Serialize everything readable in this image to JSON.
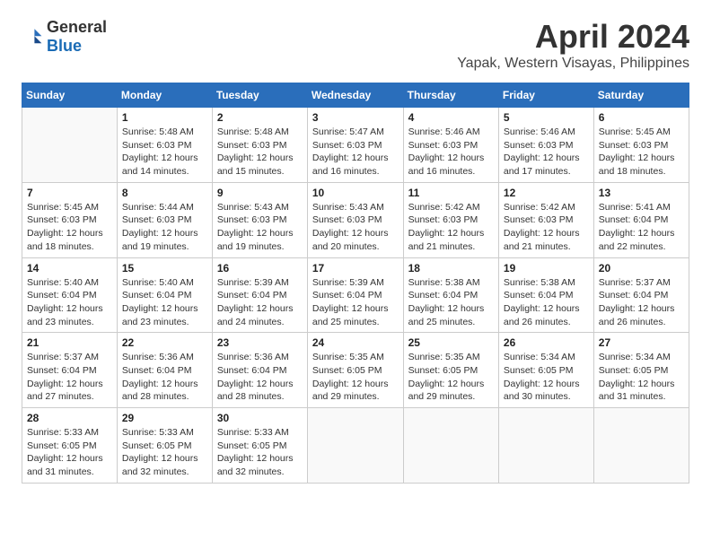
{
  "header": {
    "logo_general": "General",
    "logo_blue": "Blue",
    "title": "April 2024",
    "subtitle": "Yapak, Western Visayas, Philippines"
  },
  "days_of_week": [
    "Sunday",
    "Monday",
    "Tuesday",
    "Wednesday",
    "Thursday",
    "Friday",
    "Saturday"
  ],
  "weeks": [
    [
      {
        "day": "",
        "sunrise": "",
        "sunset": "",
        "daylight": ""
      },
      {
        "day": "1",
        "sunrise": "Sunrise: 5:48 AM",
        "sunset": "Sunset: 6:03 PM",
        "daylight": "Daylight: 12 hours and 14 minutes."
      },
      {
        "day": "2",
        "sunrise": "Sunrise: 5:48 AM",
        "sunset": "Sunset: 6:03 PM",
        "daylight": "Daylight: 12 hours and 15 minutes."
      },
      {
        "day": "3",
        "sunrise": "Sunrise: 5:47 AM",
        "sunset": "Sunset: 6:03 PM",
        "daylight": "Daylight: 12 hours and 16 minutes."
      },
      {
        "day": "4",
        "sunrise": "Sunrise: 5:46 AM",
        "sunset": "Sunset: 6:03 PM",
        "daylight": "Daylight: 12 hours and 16 minutes."
      },
      {
        "day": "5",
        "sunrise": "Sunrise: 5:46 AM",
        "sunset": "Sunset: 6:03 PM",
        "daylight": "Daylight: 12 hours and 17 minutes."
      },
      {
        "day": "6",
        "sunrise": "Sunrise: 5:45 AM",
        "sunset": "Sunset: 6:03 PM",
        "daylight": "Daylight: 12 hours and 18 minutes."
      }
    ],
    [
      {
        "day": "7",
        "sunrise": "Sunrise: 5:45 AM",
        "sunset": "Sunset: 6:03 PM",
        "daylight": "Daylight: 12 hours and 18 minutes."
      },
      {
        "day": "8",
        "sunrise": "Sunrise: 5:44 AM",
        "sunset": "Sunset: 6:03 PM",
        "daylight": "Daylight: 12 hours and 19 minutes."
      },
      {
        "day": "9",
        "sunrise": "Sunrise: 5:43 AM",
        "sunset": "Sunset: 6:03 PM",
        "daylight": "Daylight: 12 hours and 19 minutes."
      },
      {
        "day": "10",
        "sunrise": "Sunrise: 5:43 AM",
        "sunset": "Sunset: 6:03 PM",
        "daylight": "Daylight: 12 hours and 20 minutes."
      },
      {
        "day": "11",
        "sunrise": "Sunrise: 5:42 AM",
        "sunset": "Sunset: 6:03 PM",
        "daylight": "Daylight: 12 hours and 21 minutes."
      },
      {
        "day": "12",
        "sunrise": "Sunrise: 5:42 AM",
        "sunset": "Sunset: 6:03 PM",
        "daylight": "Daylight: 12 hours and 21 minutes."
      },
      {
        "day": "13",
        "sunrise": "Sunrise: 5:41 AM",
        "sunset": "Sunset: 6:04 PM",
        "daylight": "Daylight: 12 hours and 22 minutes."
      }
    ],
    [
      {
        "day": "14",
        "sunrise": "Sunrise: 5:40 AM",
        "sunset": "Sunset: 6:04 PM",
        "daylight": "Daylight: 12 hours and 23 minutes."
      },
      {
        "day": "15",
        "sunrise": "Sunrise: 5:40 AM",
        "sunset": "Sunset: 6:04 PM",
        "daylight": "Daylight: 12 hours and 23 minutes."
      },
      {
        "day": "16",
        "sunrise": "Sunrise: 5:39 AM",
        "sunset": "Sunset: 6:04 PM",
        "daylight": "Daylight: 12 hours and 24 minutes."
      },
      {
        "day": "17",
        "sunrise": "Sunrise: 5:39 AM",
        "sunset": "Sunset: 6:04 PM",
        "daylight": "Daylight: 12 hours and 25 minutes."
      },
      {
        "day": "18",
        "sunrise": "Sunrise: 5:38 AM",
        "sunset": "Sunset: 6:04 PM",
        "daylight": "Daylight: 12 hours and 25 minutes."
      },
      {
        "day": "19",
        "sunrise": "Sunrise: 5:38 AM",
        "sunset": "Sunset: 6:04 PM",
        "daylight": "Daylight: 12 hours and 26 minutes."
      },
      {
        "day": "20",
        "sunrise": "Sunrise: 5:37 AM",
        "sunset": "Sunset: 6:04 PM",
        "daylight": "Daylight: 12 hours and 26 minutes."
      }
    ],
    [
      {
        "day": "21",
        "sunrise": "Sunrise: 5:37 AM",
        "sunset": "Sunset: 6:04 PM",
        "daylight": "Daylight: 12 hours and 27 minutes."
      },
      {
        "day": "22",
        "sunrise": "Sunrise: 5:36 AM",
        "sunset": "Sunset: 6:04 PM",
        "daylight": "Daylight: 12 hours and 28 minutes."
      },
      {
        "day": "23",
        "sunrise": "Sunrise: 5:36 AM",
        "sunset": "Sunset: 6:04 PM",
        "daylight": "Daylight: 12 hours and 28 minutes."
      },
      {
        "day": "24",
        "sunrise": "Sunrise: 5:35 AM",
        "sunset": "Sunset: 6:05 PM",
        "daylight": "Daylight: 12 hours and 29 minutes."
      },
      {
        "day": "25",
        "sunrise": "Sunrise: 5:35 AM",
        "sunset": "Sunset: 6:05 PM",
        "daylight": "Daylight: 12 hours and 29 minutes."
      },
      {
        "day": "26",
        "sunrise": "Sunrise: 5:34 AM",
        "sunset": "Sunset: 6:05 PM",
        "daylight": "Daylight: 12 hours and 30 minutes."
      },
      {
        "day": "27",
        "sunrise": "Sunrise: 5:34 AM",
        "sunset": "Sunset: 6:05 PM",
        "daylight": "Daylight: 12 hours and 31 minutes."
      }
    ],
    [
      {
        "day": "28",
        "sunrise": "Sunrise: 5:33 AM",
        "sunset": "Sunset: 6:05 PM",
        "daylight": "Daylight: 12 hours and 31 minutes."
      },
      {
        "day": "29",
        "sunrise": "Sunrise: 5:33 AM",
        "sunset": "Sunset: 6:05 PM",
        "daylight": "Daylight: 12 hours and 32 minutes."
      },
      {
        "day": "30",
        "sunrise": "Sunrise: 5:33 AM",
        "sunset": "Sunset: 6:05 PM",
        "daylight": "Daylight: 12 hours and 32 minutes."
      },
      {
        "day": "",
        "sunrise": "",
        "sunset": "",
        "daylight": ""
      },
      {
        "day": "",
        "sunrise": "",
        "sunset": "",
        "daylight": ""
      },
      {
        "day": "",
        "sunrise": "",
        "sunset": "",
        "daylight": ""
      },
      {
        "day": "",
        "sunrise": "",
        "sunset": "",
        "daylight": ""
      }
    ]
  ]
}
